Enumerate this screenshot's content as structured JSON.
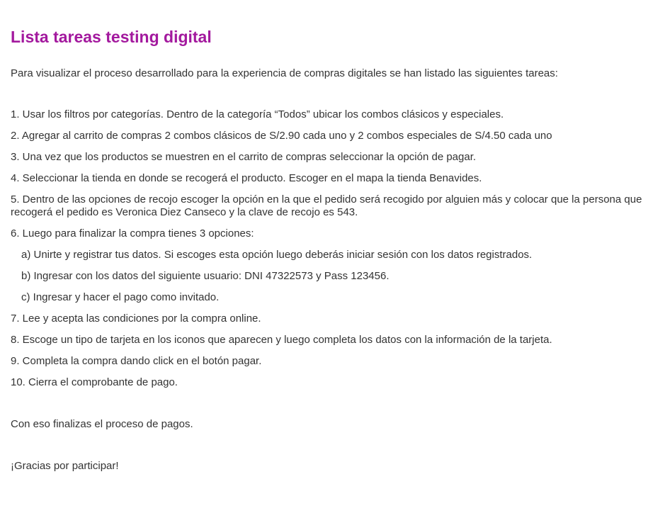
{
  "title": "Lista tareas testing digital",
  "intro": "Para visualizar el proceso desarrollado para la experiencia de compras digitales se han listado las siguientes tareas:",
  "tasks": [
    "1. Usar los filtros por categorías. Dentro de la categoría “Todos” ubicar los combos clásicos y especiales.",
    "2. Agregar al carrito de compras 2 combos clásicos de S/2.90 cada uno y 2 combos especiales de S/4.50 cada uno",
    "3. Una vez que los productos se muestren en el carrito de compras seleccionar la opción de pagar.",
    "4. Seleccionar la tienda en donde se recogerá el producto. Escoger en el mapa la tienda Benavides.",
    "5. Dentro de las opciones de recojo escoger la opción en la que el pedido será recogido por alguien más y colocar que la persona que recogerá el pedido es Veronica Diez Canseco y la clave de recojo es 543.",
    "6. Luego para finalizar la compra tienes 3 opciones:",
    "a) Unirte y registrar tus datos. Si escoges esta opción luego deberás iniciar sesión con los datos registrados.",
    "b) Ingresar con los datos del siguiente usuario: DNI 47322573 y Pass 123456.",
    "c) Ingresar y hacer el pago como invitado.",
    "7. Lee y acepta las condiciones por la compra online.",
    "8. Escoge un tipo de tarjeta en los iconos que aparecen y luego completa los datos con la información de la tarjeta.",
    "9. Completa la compra dando click en el botón pagar.",
    "10. Cierra el comprobante de pago."
  ],
  "closing": "Con eso finalizas el proceso de pagos.",
  "thanks": "¡Gracias por participar!",
  "colors": {
    "title": "#a3199e",
    "text": "#333333",
    "background": "#ffffff"
  }
}
